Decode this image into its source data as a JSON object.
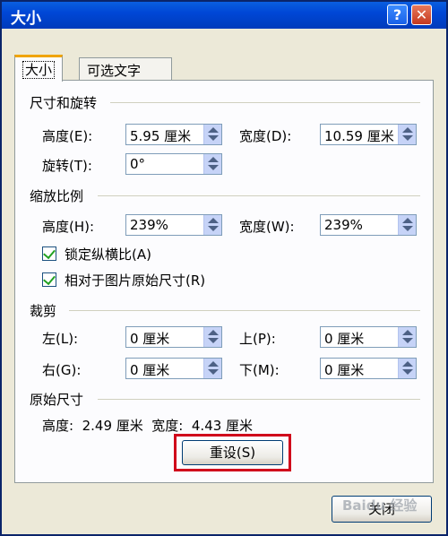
{
  "window": {
    "title": "大小"
  },
  "tabs": [
    "大小",
    "可选文字"
  ],
  "size_rotate": {
    "heading": "尺寸和旋转",
    "height_label": "高度(E):",
    "height_value": "5.95 厘米",
    "width_label": "宽度(D):",
    "width_value": "10.59 厘米",
    "rotate_label": "旋转(T):",
    "rotate_value": "0°"
  },
  "scale": {
    "heading": "缩放比例",
    "height_label": "高度(H):",
    "height_value": "239%",
    "width_label": "宽度(W):",
    "width_value": "239%",
    "lock_aspect_label": "锁定纵横比(A)",
    "lock_aspect_checked": true,
    "relative_label": "相对于图片原始尺寸(R)",
    "relative_checked": true
  },
  "crop": {
    "heading": "裁剪",
    "left_label": "左(L):",
    "left_value": "0 厘米",
    "top_label": "上(P):",
    "top_value": "0 厘米",
    "right_label": "右(G):",
    "right_value": "0 厘米",
    "bottom_label": "下(M):",
    "bottom_value": "0 厘米"
  },
  "original": {
    "heading": "原始尺寸",
    "text": "高度:  2.49 厘米  宽度:  4.43 厘米"
  },
  "buttons": {
    "reset": "重设(S)",
    "close": "关闭"
  },
  "watermark": "Baidu 经验",
  "colors": {
    "titlebar": "#0047d6",
    "highlight": "#d0021b",
    "dialog_bg": "#ece9d8"
  }
}
